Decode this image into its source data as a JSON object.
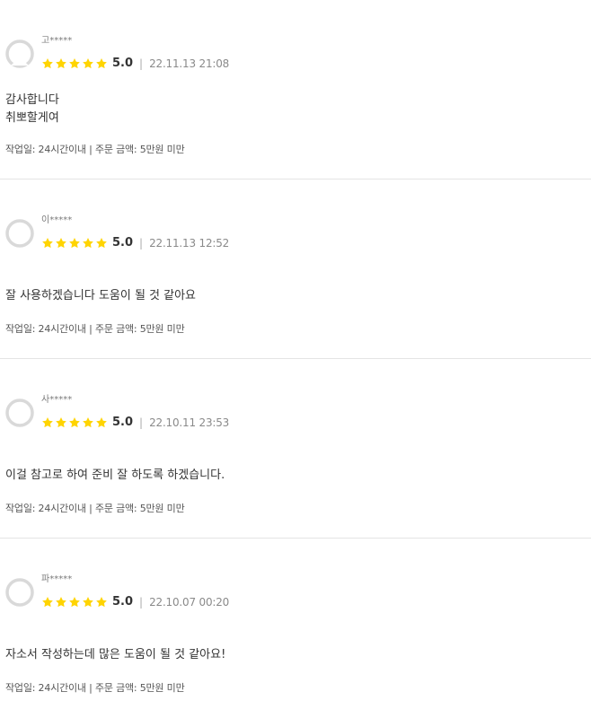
{
  "reviews": [
    {
      "username": "고*****",
      "score": "5.0",
      "divider": "|",
      "date": "22.11.13 21:08",
      "body_lines": [
        "감사합니다",
        "취뽀할게여"
      ],
      "meta": "작업일: 24시간이내 | 주문 금액: 5만원 미만"
    },
    {
      "username": "이*****",
      "score": "5.0",
      "divider": "|",
      "date": "22.11.13 12:52",
      "body_lines": [
        "잘 사용하겠습니다 도움이 될 것 같아요"
      ],
      "meta": "작업일: 24시간이내 | 주문 금액: 5만원 미만"
    },
    {
      "username": "사*****",
      "score": "5.0",
      "divider": "|",
      "date": "22.10.11 23:53",
      "body_lines": [
        "이걸 참고로 하여 준비 잘 하도록 하겠습니다."
      ],
      "meta": "작업일: 24시간이내 | 주문 금액: 5만원 미만"
    },
    {
      "username": "파*****",
      "score": "5.0",
      "divider": "|",
      "date": "22.10.07 00:20",
      "body_lines": [
        "자소서 작성하는데 많은 도움이 될 것 같아요!"
      ],
      "meta": "작업일: 24시간이내 | 주문 금액: 5만원 미만"
    }
  ],
  "rating": {
    "stars": 5,
    "max_stars": 5,
    "star_icon": "star-icon",
    "star_color": "#ffd400"
  },
  "avatar_icon": "default-avatar-icon",
  "colors": {
    "divider_line": "#e4e4e4",
    "avatar_ring": "#d9d9d9"
  }
}
